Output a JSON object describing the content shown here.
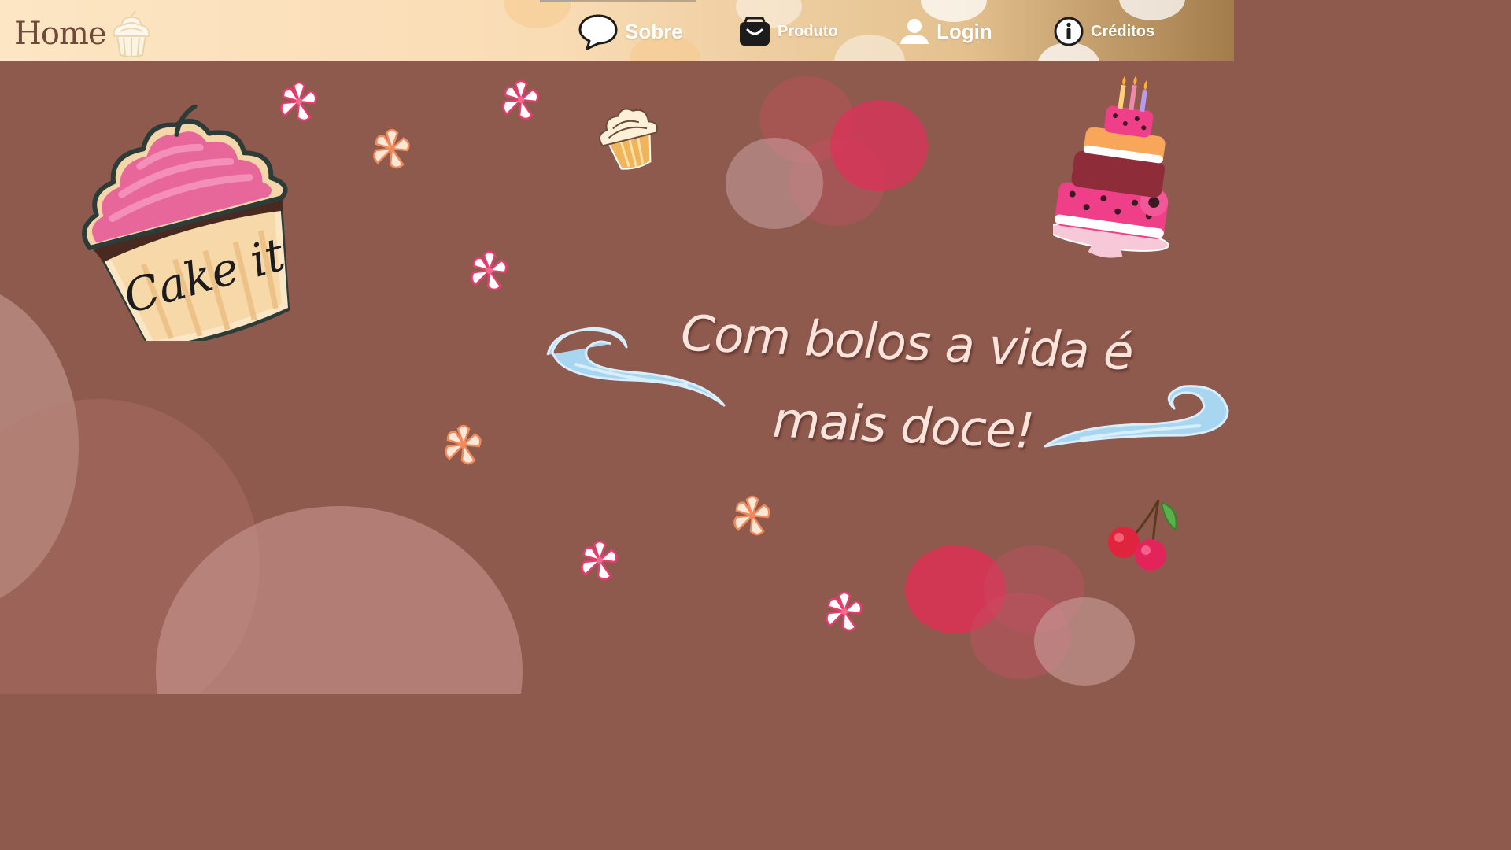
{
  "header": {
    "home_label": "Home",
    "nav": [
      {
        "label": "Sobre",
        "icon": "speech-bubble-icon"
      },
      {
        "label": "Produto",
        "icon": "shopping-bag-icon"
      },
      {
        "label": "Login",
        "icon": "user-icon"
      },
      {
        "label": "Créditos",
        "icon": "info-icon"
      }
    ]
  },
  "hero": {
    "logo_text": "Cake it",
    "slogan": "Com bolos a vida é mais doce!"
  },
  "colors": {
    "background": "#8f5a4e",
    "header_light": "#fde6c4",
    "header_dark": "#a37c4b",
    "slogan": "#fbe4dc",
    "frosting_pink": "#e8679b",
    "swirl_blue": "#a8d6f0"
  }
}
